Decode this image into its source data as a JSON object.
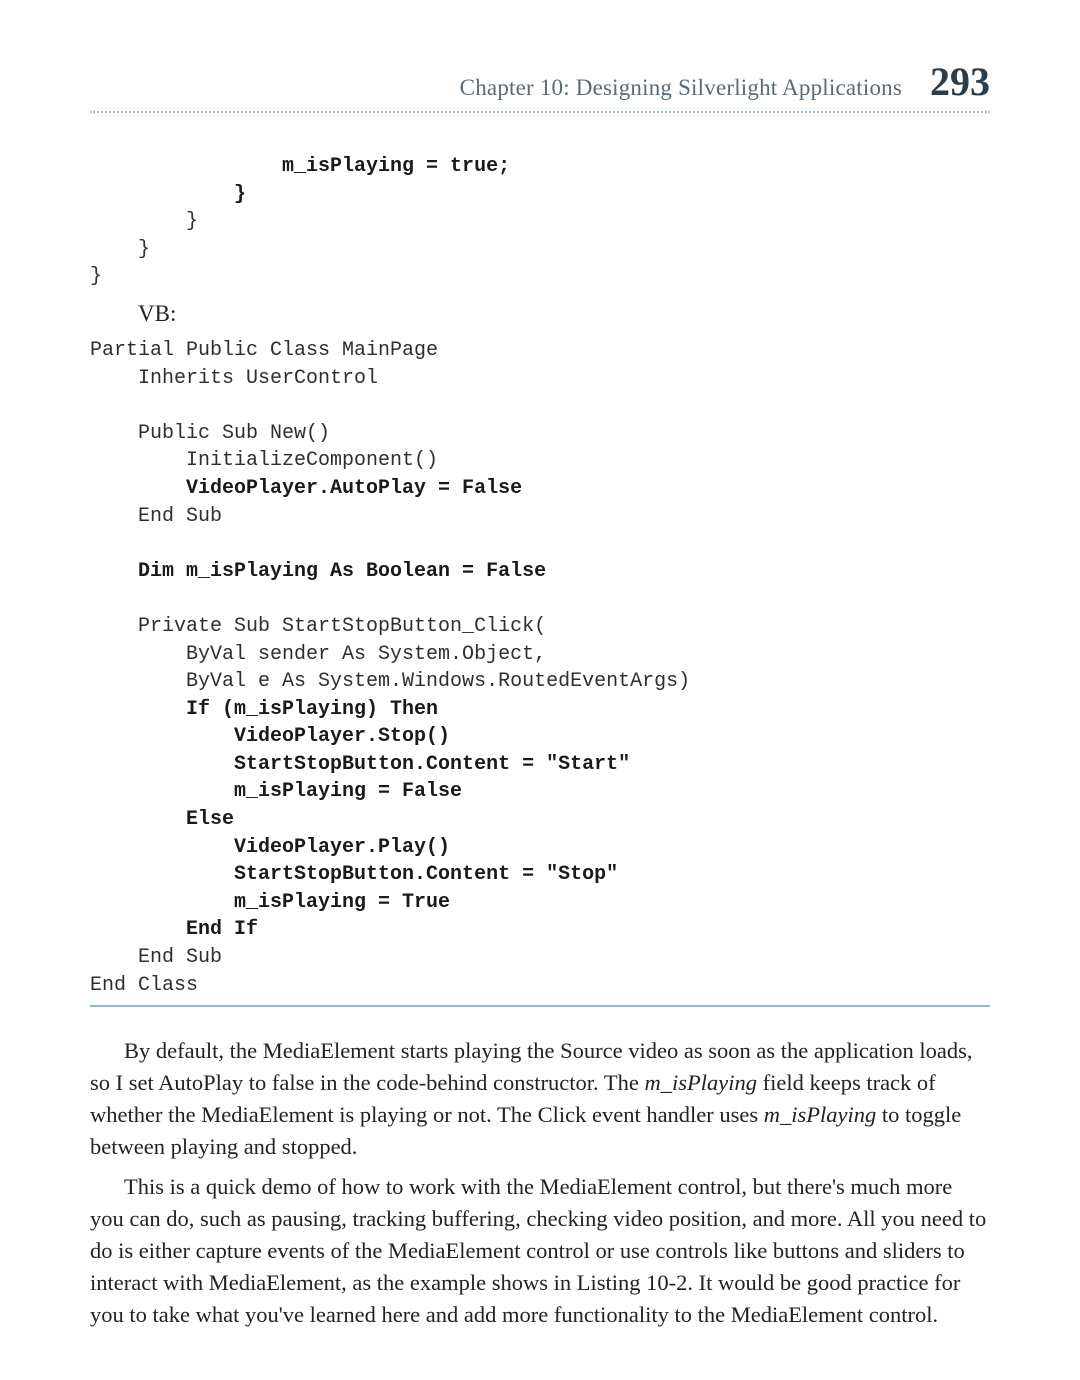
{
  "header": {
    "chapter_label": "Chapter 10:   Designing Silverlight Applications",
    "page_number": "293"
  },
  "code": {
    "cs_tail": {
      "l1": "                m_isPlaying = true;",
      "l2": "            }",
      "l3": "        }",
      "l4": "    }",
      "l5": "}"
    },
    "vb_label": "VB:",
    "vb": {
      "l1": "Partial Public Class MainPage",
      "l2": "    Inherits UserControl",
      "blank1": " ",
      "l3": "    Public Sub New()",
      "l4": "        InitializeComponent()",
      "l5": "        VideoPlayer.AutoPlay = False",
      "l6": "    End Sub",
      "blank2": " ",
      "l7": "    Dim m_isPlaying As Boolean = False",
      "blank3": " ",
      "l8": "    Private Sub StartStopButton_Click(",
      "l9": "        ByVal sender As System.Object,",
      "l10": "        ByVal e As System.Windows.RoutedEventArgs)",
      "l11": "        If (m_isPlaying) Then",
      "l12": "            VideoPlayer.Stop()",
      "l13": "            StartStopButton.Content = \"Start\"",
      "l14": "            m_isPlaying = False",
      "l15": "        Else",
      "l16": "            VideoPlayer.Play()",
      "l17": "            StartStopButton.Content = \"Stop\"",
      "l18": "            m_isPlaying = True",
      "l19": "        End If",
      "l20": "    End Sub",
      "l21": "End Class"
    }
  },
  "body": {
    "p1_a": "By default, the MediaElement starts playing the Source video as soon as the application loads, so I set AutoPlay to false in the code-behind constructor. The ",
    "p1_i1": "m_isPlaying",
    "p1_b": " field keeps track of whether the MediaElement is playing or not. The Click event handler uses ",
    "p1_i2": "m_isPlaying",
    "p1_c": " to toggle between playing and stopped.",
    "p2": "This is a quick demo of how to work with the MediaElement control, but there's much more you can do, such as pausing, tracking buffering, checking video position, and more. All you need to do is either capture events of the MediaElement control or use controls like buttons and sliders to interact with MediaElement, as the example shows in Listing 10-2. It would be good practice for you to take what you've learned here and add more functionality to the MediaElement control."
  }
}
